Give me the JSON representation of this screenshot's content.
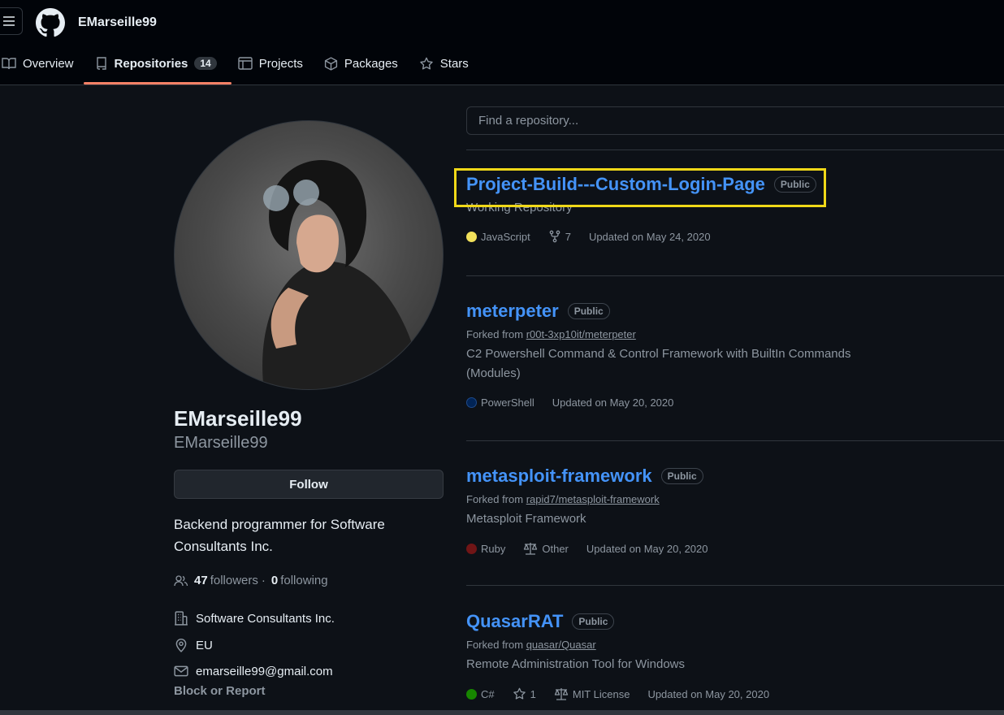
{
  "header": {
    "username": "EMarseille99",
    "tabs": [
      {
        "label": "Overview",
        "icon": "book-icon"
      },
      {
        "label": "Repositories",
        "icon": "repo-icon",
        "count": "14"
      },
      {
        "label": "Projects",
        "icon": "table-icon"
      },
      {
        "label": "Packages",
        "icon": "package-icon"
      },
      {
        "label": "Stars",
        "icon": "star-icon"
      }
    ]
  },
  "profile": {
    "name": "EMarseille99",
    "login": "EMarseille99",
    "follow_label": "Follow",
    "bio": "Backend programmer for Software Consultants Inc.",
    "followers_count": "47",
    "followers_label": "followers",
    "sep": "·",
    "following_count": "0",
    "following_label": "following",
    "company": "Software Consultants Inc.",
    "location": "EU",
    "email": "emarseille99@gmail.com",
    "block_label": "Block or Report"
  },
  "search": {
    "placeholder": "Find a repository..."
  },
  "repos": [
    {
      "name": "Project-Build---Custom-Login-Page",
      "visibility": "Public",
      "description": "Working Repository",
      "language": "JavaScript",
      "language_color": "#f1e05a",
      "forks": "7",
      "updated": "Updated on May 24, 2020"
    },
    {
      "name": "meterpeter",
      "visibility": "Public",
      "forked_prefix": "Forked from",
      "forked_from": "r00t-3xp10it/meterpeter",
      "description": "C2 Powershell Command & Control Framework with BuiltIn Commands (Modules)",
      "language": "PowerShell",
      "language_color": "#012456",
      "updated": "Updated on May 20, 2020"
    },
    {
      "name": "metasploit-framework",
      "visibility": "Public",
      "forked_prefix": "Forked from",
      "forked_from": "rapid7/metasploit-framework",
      "description": "Metasploit Framework",
      "language": "Ruby",
      "language_color": "#701516",
      "license": "Other",
      "updated": "Updated on May 20, 2020"
    },
    {
      "name": "QuasarRAT",
      "visibility": "Public",
      "forked_prefix": "Forked from",
      "forked_from": "quasar/Quasar",
      "description": "Remote Administration Tool for Windows",
      "language": "C#",
      "language_color": "#178600",
      "stars": "1",
      "license": "MIT License",
      "updated": "Updated on May 20, 2020"
    }
  ],
  "colors": {
    "background": "#0d1117",
    "link": "#4493f8",
    "active_tab_underline": "#f78166",
    "highlight_box": "#f0d818"
  }
}
